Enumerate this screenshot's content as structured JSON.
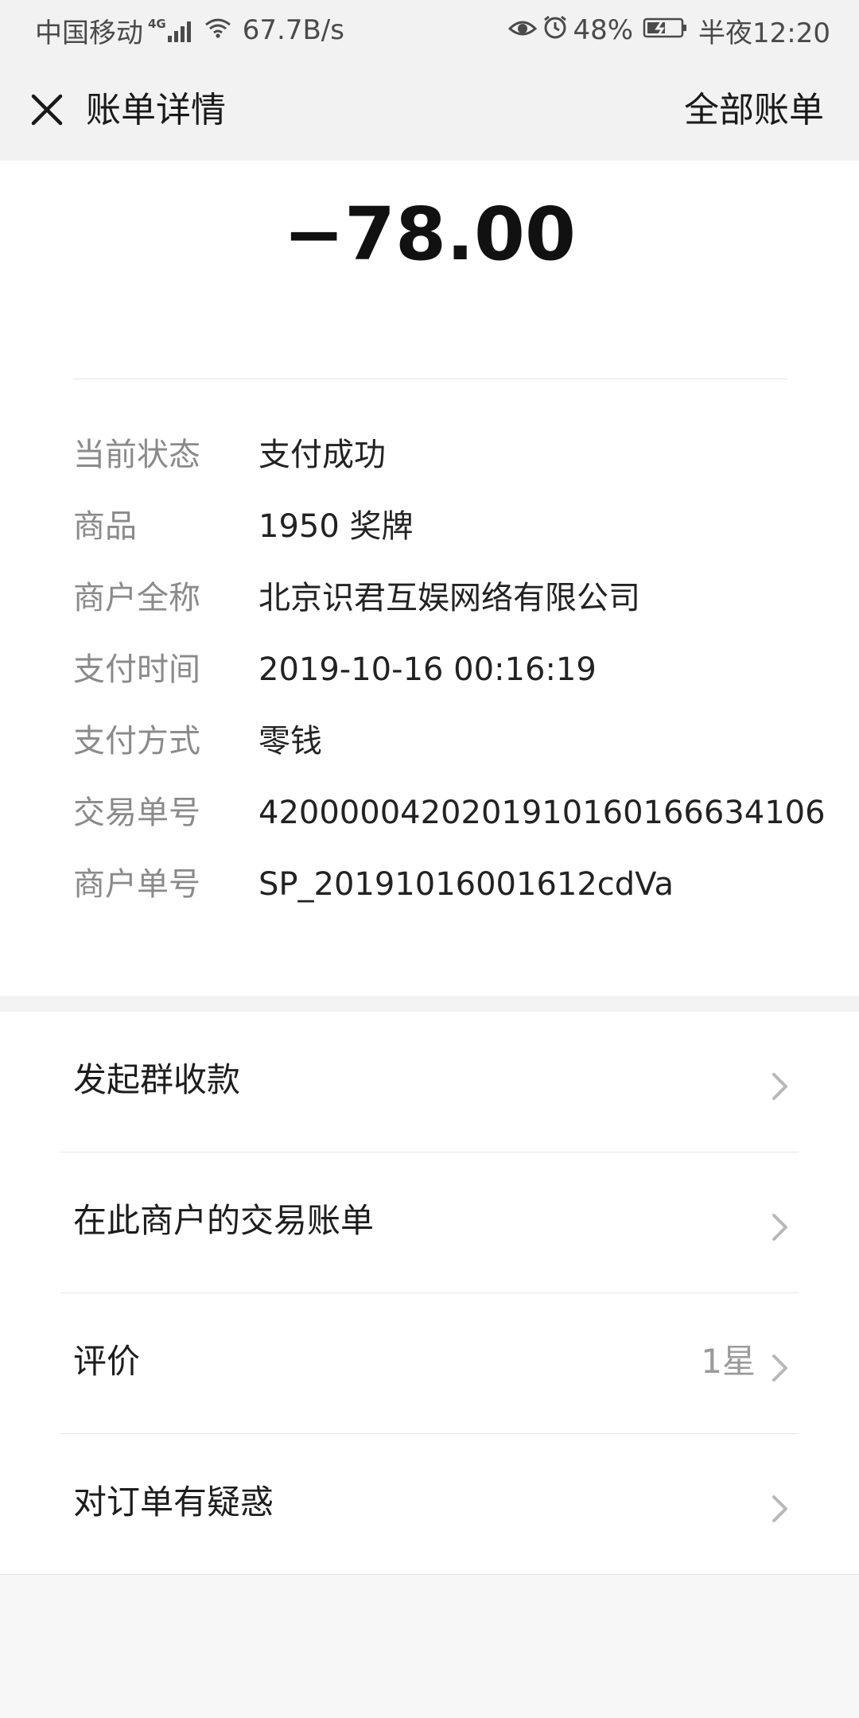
{
  "status_bar": {
    "carrier": "中国移动",
    "network_type": "4G",
    "speed": "67.7B/s",
    "battery_percent": "48%",
    "time": "半夜12:20",
    "icons": [
      "signal-icon",
      "wifi-icon",
      "eye-icon",
      "alarm-icon",
      "battery-charging-icon"
    ]
  },
  "nav": {
    "close_icon": "close-icon",
    "title": "账单详情",
    "right_link": "全部账单"
  },
  "bill": {
    "amount": "−78.00",
    "rows": [
      {
        "label": "当前状态",
        "value": "支付成功"
      },
      {
        "label": "商品",
        "value": "1950 奖牌"
      },
      {
        "label": "商户全称",
        "value": "北京识君互娱网络有限公司"
      },
      {
        "label": "支付时间",
        "value": "2019-10-16 00:16:19"
      },
      {
        "label": "支付方式",
        "value": "零钱"
      },
      {
        "label": "交易单号",
        "value": "4200000420201910160166634106"
      },
      {
        "label": "商户单号",
        "value": "SP_20191016001612cdVa"
      }
    ]
  },
  "actions": [
    {
      "label": "发起群收款",
      "value": ""
    },
    {
      "label": "在此商户的交易账单",
      "value": ""
    },
    {
      "label": "评价",
      "value": "1星"
    },
    {
      "label": "对订单有疑惑",
      "value": ""
    }
  ],
  "colors": {
    "nav_bg": "#f2f2f2",
    "card_bg": "#ffffff",
    "page_bg": "#f7f7f7",
    "label_gray": "#8a8a8a",
    "text_dark": "#191919"
  }
}
